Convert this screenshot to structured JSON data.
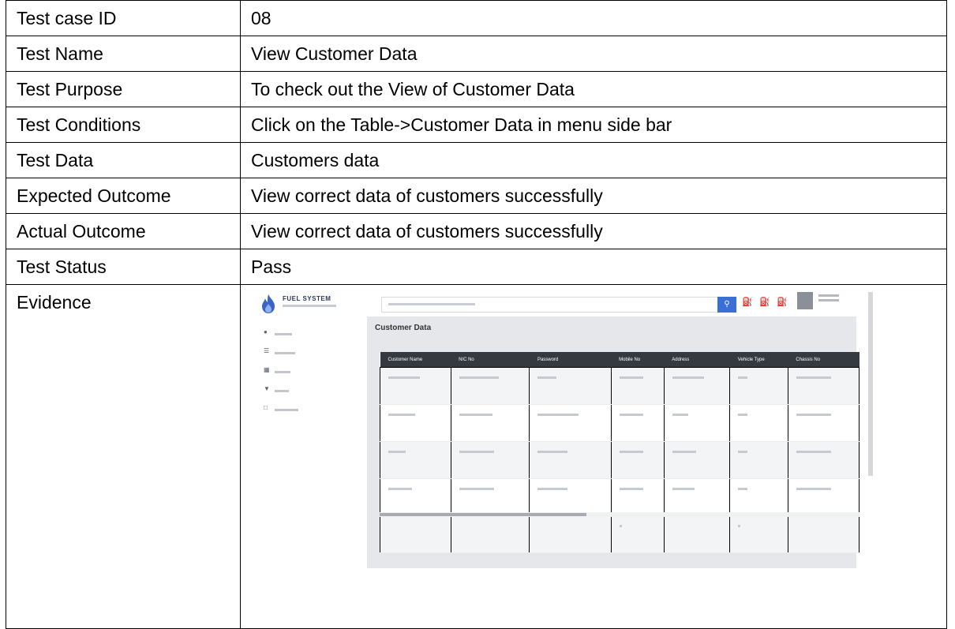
{
  "rows": [
    {
      "label": "Test case ID",
      "value": "08"
    },
    {
      "label": "Test Name",
      "value": "View Customer Data"
    },
    {
      "label": "Test Purpose",
      "value": "To check out the View of Customer Data"
    },
    {
      "label": "Test Conditions",
      "value": "Click on the Table->Customer Data in menu side bar"
    },
    {
      "label": "Test Data",
      "value": "Customers data"
    },
    {
      "label": "Expected Outcome",
      "value": "View correct data of customers successfully"
    },
    {
      "label": "Actual Outcome",
      "value": "View correct data of customers successfully"
    },
    {
      "label": "Test Status",
      "value": "Pass"
    },
    {
      "label": "Evidence",
      "value": ""
    }
  ],
  "evidence": {
    "brand": "FUEL SYSTEM",
    "logo_icon": "flame-icon",
    "search_icon": "search-icon",
    "header_icons": [
      "gas-pump-icon",
      "gas-pump-icon",
      "gas-pump-icon"
    ],
    "nav_icons": [
      "home-icon",
      "list-icon",
      "table-icon",
      "map-pin-icon",
      "monitor-icon"
    ],
    "page_title": "Customer Data",
    "columns": [
      "Customer Name",
      "NIC No",
      "Password",
      "Mobile No",
      "Address",
      "Vehicle Type",
      "Chassis No"
    ],
    "colors": {
      "header_row": "#343a40",
      "search_button": "#3a6fd8",
      "icon_accent": "#d0506a"
    }
  }
}
